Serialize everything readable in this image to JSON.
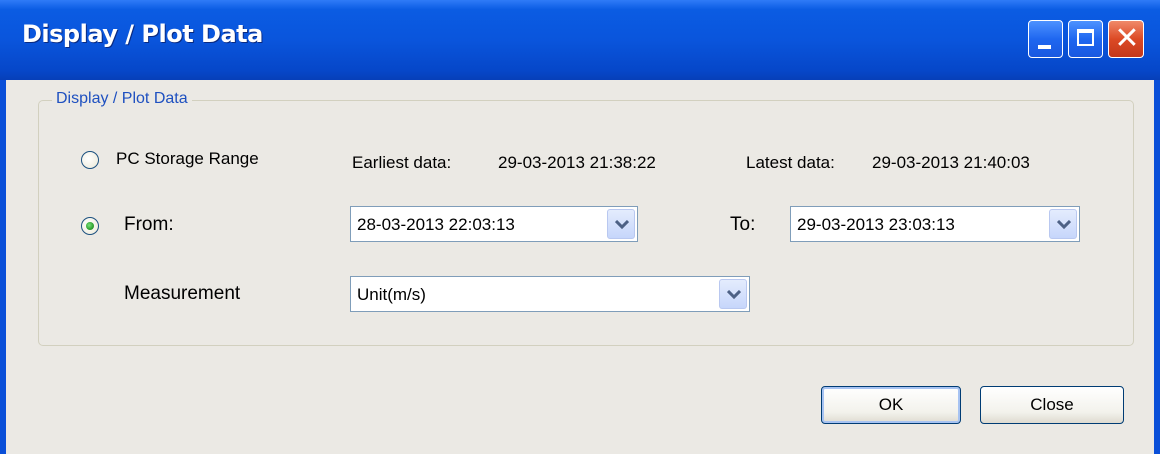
{
  "window": {
    "title": "Display / Plot Data"
  },
  "titlebar_buttons": {
    "minimize_icon": "minimize-icon",
    "maximize_icon": "maximize-icon",
    "close_icon": "close-icon",
    "close_glyph": "✕"
  },
  "group": {
    "legend": "Display / Plot Data"
  },
  "range": {
    "pc_storage_label": "PC Storage Range",
    "pc_storage_selected": false,
    "earliest_label": "Earliest data:",
    "earliest_value": "29-03-2013 21:38:22",
    "latest_label": "Latest data:",
    "latest_value": "29-03-2013 21:40:03",
    "from_label": "From:",
    "from_selected": true,
    "from_value": "28-03-2013 22:03:13",
    "to_label": "To:",
    "to_value": "29-03-2013 23:03:13"
  },
  "measurement": {
    "label": "Measurement",
    "value": "Unit(m/s)"
  },
  "buttons": {
    "ok": "OK",
    "close": "Close"
  },
  "colors": {
    "titlebar": "#0a55dc",
    "client": "#ebe9e4",
    "legend_text": "#1e50c0",
    "radio_selected": "#2fa12f"
  }
}
